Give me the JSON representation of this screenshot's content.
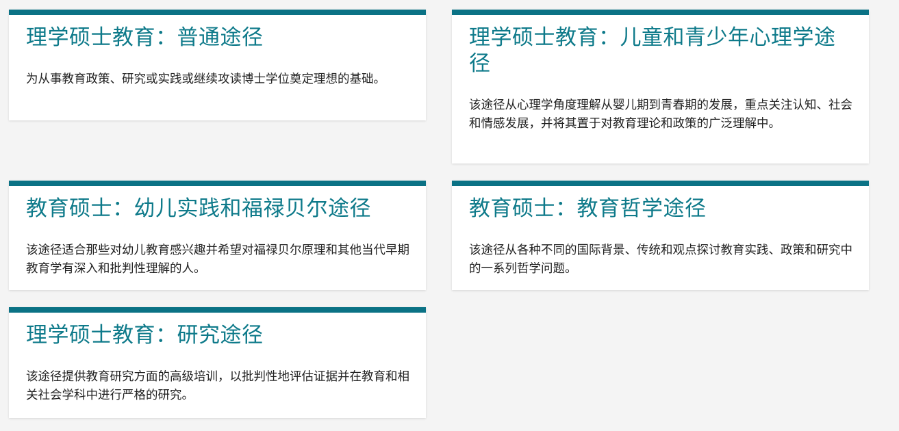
{
  "accent_color": "#0b7285",
  "cards": [
    {
      "title": "理学硕士教育：普通途径",
      "description": "为从事教育政策、研究或实践或继续攻读博士学位奠定理想的基础。"
    },
    {
      "title": "理学硕士教育：儿童和青少年心理学途径",
      "description": "该途径从心理学角度理解从婴儿期到青春期的发展，重点关注认知、社会和情感发展，并将其置于对教育理论和政策的广泛理解中。"
    },
    {
      "title": "教育硕士：幼儿实践和福禄贝尔途径",
      "description": "该途径适合那些对幼儿教育感兴趣并希望对福禄贝尔原理和其他当代早期教育学有深入和批判性理解的人。"
    },
    {
      "title": "教育硕士：教育哲学途径",
      "description": "该途径从各种不同的国际背景、传统和观点探讨教育实践、政策和研究中的一系列哲学问题。"
    },
    {
      "title": "理学硕士教育：研究途径",
      "description": "该途径提供教育研究方面的高级培训，以批判性地评估证据并在教育和相关社会学科中进行严格的研究。"
    }
  ]
}
